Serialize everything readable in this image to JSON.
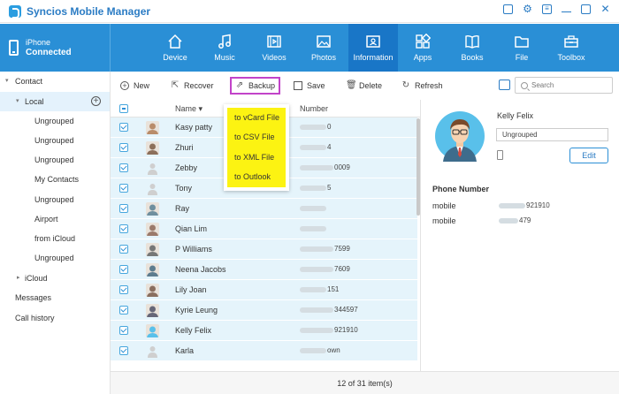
{
  "app": {
    "title": "Syncios Mobile Manager"
  },
  "window_controls": [
    "restore",
    "settings",
    "menu",
    "minimize",
    "maximize",
    "close"
  ],
  "device": {
    "name": "iPhone",
    "status": "Connected"
  },
  "nav": {
    "tabs": [
      {
        "label": "Device",
        "icon": "home-icon"
      },
      {
        "label": "Music",
        "icon": "music-note-icon"
      },
      {
        "label": "Videos",
        "icon": "film-icon"
      },
      {
        "label": "Photos",
        "icon": "image-icon"
      },
      {
        "label": "Information",
        "icon": "contact-card-icon",
        "active": true
      },
      {
        "label": "Apps",
        "icon": "apps-grid-icon"
      },
      {
        "label": "Books",
        "icon": "book-icon"
      },
      {
        "label": "File",
        "icon": "folder-icon"
      },
      {
        "label": "Toolbox",
        "icon": "toolbox-icon"
      }
    ]
  },
  "sidebar": {
    "items": [
      {
        "label": "Contact",
        "level": 0,
        "caret": "open"
      },
      {
        "label": "Local",
        "level": 1,
        "caret": "open",
        "active": true
      },
      {
        "label": "Ungrouped",
        "level": 2
      },
      {
        "label": "Ungrouped",
        "level": 2
      },
      {
        "label": "Ungrouped",
        "level": 2
      },
      {
        "label": "My Contacts",
        "level": 2
      },
      {
        "label": "Ungrouped",
        "level": 2
      },
      {
        "label": "Airport",
        "level": 2
      },
      {
        "label": "from iCloud",
        "level": 2
      },
      {
        "label": "Ungrouped",
        "level": 2
      },
      {
        "label": "iCloud",
        "level": 1,
        "caret": "closed"
      },
      {
        "label": "Messages",
        "level": 0
      },
      {
        "label": "Call history",
        "level": 0
      }
    ]
  },
  "toolbar": {
    "new": "New",
    "recover": "Recover",
    "backup": "Backup",
    "save": "Save",
    "delete": "Delete",
    "refresh": "Refresh",
    "search_placeholder": "Search"
  },
  "backup_menu": [
    "to vCard File",
    "to CSV File",
    "to XML File",
    "to Outlook"
  ],
  "table": {
    "columns": {
      "name": "Name",
      "number": "Number"
    },
    "rows": [
      {
        "name": "Kasy patty",
        "number_visible": "0",
        "avatar": "photo"
      },
      {
        "name": "Zhuri",
        "number_visible": "4",
        "avatar": "photo"
      },
      {
        "name": "Zebby",
        "number_visible": "0009",
        "avatar": "default"
      },
      {
        "name": "Tony",
        "number_visible": "5",
        "avatar": "default"
      },
      {
        "name": "Ray",
        "number_visible": "",
        "avatar": "photo"
      },
      {
        "name": "Qian Lim",
        "number_visible": "",
        "avatar": "photo"
      },
      {
        "name": "P Williams",
        "number_visible": "7599",
        "avatar": "photo"
      },
      {
        "name": "Neena Jacobs",
        "number_visible": "7609",
        "avatar": "photo"
      },
      {
        "name": "Lily Joan",
        "number_visible": "151",
        "avatar": "photo"
      },
      {
        "name": "Kyrie Leung",
        "number_visible": "344597",
        "avatar": "photo"
      },
      {
        "name": "Kelly Felix",
        "number_visible": "921910",
        "avatar": "photo"
      },
      {
        "name": "Karla",
        "number_visible": "own",
        "avatar": "default"
      }
    ]
  },
  "status": {
    "count_text": "12 of 31 item(s)"
  },
  "detail": {
    "name": "Kelly Felix",
    "group": "Ungrouped",
    "edit": "Edit",
    "phone_section": "Phone Number",
    "phones": [
      {
        "label": "mobile",
        "value_visible": "921910"
      },
      {
        "label": "mobile",
        "value_visible": "479"
      }
    ]
  },
  "colors": {
    "accent": "#2a8fd6",
    "nav_active": "#1976c7",
    "row_selected": "#e5f4fb",
    "menu_highlight": "#fcf312",
    "backup_outline": "#c243c9"
  }
}
